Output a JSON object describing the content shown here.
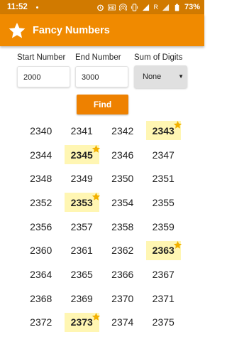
{
  "status_bar": {
    "time": "11:52",
    "battery": "73%",
    "network": "R"
  },
  "app_bar": {
    "title": "Fancy Numbers"
  },
  "form": {
    "start_label": "Start Number",
    "start_value": "2000",
    "end_label": "End Number",
    "end_value": "3000",
    "sum_label": "Sum of Digits",
    "sum_value": "None"
  },
  "find_label": "Find",
  "colors": {
    "accent": "#f08a00",
    "status": "#d17a00",
    "highlight": "#fff6b3",
    "star": "#f2b000"
  },
  "numbers": [
    [
      {
        "n": "2340",
        "fancy": false
      },
      {
        "n": "2341",
        "fancy": false
      },
      {
        "n": "2342",
        "fancy": false
      },
      {
        "n": "2343",
        "fancy": true
      }
    ],
    [
      {
        "n": "2344",
        "fancy": false
      },
      {
        "n": "2345",
        "fancy": true
      },
      {
        "n": "2346",
        "fancy": false
      },
      {
        "n": "2347",
        "fancy": false
      }
    ],
    [
      {
        "n": "2348",
        "fancy": false
      },
      {
        "n": "2349",
        "fancy": false
      },
      {
        "n": "2350",
        "fancy": false
      },
      {
        "n": "2351",
        "fancy": false
      }
    ],
    [
      {
        "n": "2352",
        "fancy": false
      },
      {
        "n": "2353",
        "fancy": true
      },
      {
        "n": "2354",
        "fancy": false
      },
      {
        "n": "2355",
        "fancy": false
      }
    ],
    [
      {
        "n": "2356",
        "fancy": false
      },
      {
        "n": "2357",
        "fancy": false
      },
      {
        "n": "2358",
        "fancy": false
      },
      {
        "n": "2359",
        "fancy": false
      }
    ],
    [
      {
        "n": "2360",
        "fancy": false
      },
      {
        "n": "2361",
        "fancy": false
      },
      {
        "n": "2362",
        "fancy": false
      },
      {
        "n": "2363",
        "fancy": true
      }
    ],
    [
      {
        "n": "2364",
        "fancy": false
      },
      {
        "n": "2365",
        "fancy": false
      },
      {
        "n": "2366",
        "fancy": false
      },
      {
        "n": "2367",
        "fancy": false
      }
    ],
    [
      {
        "n": "2368",
        "fancy": false
      },
      {
        "n": "2369",
        "fancy": false
      },
      {
        "n": "2370",
        "fancy": false
      },
      {
        "n": "2371",
        "fancy": false
      }
    ],
    [
      {
        "n": "2372",
        "fancy": false
      },
      {
        "n": "2373",
        "fancy": true
      },
      {
        "n": "2374",
        "fancy": false
      },
      {
        "n": "2375",
        "fancy": false
      }
    ]
  ]
}
